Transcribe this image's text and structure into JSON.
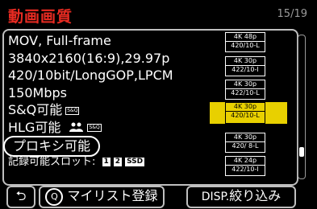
{
  "header": {
    "title": "動画画質",
    "page": "15/19"
  },
  "info": {
    "line1": "MOV, Full-frame",
    "line2": "3840x2160(16:9),29.97p",
    "line3": "420/10bit/LongGOP,LPCM",
    "line4": "150Mbps",
    "line5": "S&Q可能",
    "line5_badge": "S&Q",
    "line6": "HLG可能",
    "line6_badge": "S&Q",
    "line7": "プロキシ可能",
    "line8": "記録可能スロット:",
    "slot1": "1",
    "slot2": "2",
    "slot3": "SSD"
  },
  "modes": [
    {
      "top": "4K 48p",
      "bottom": "420/10-L"
    },
    {
      "top": "4K 30p",
      "bottom": "422/10-I"
    },
    {
      "top": "4K 30p",
      "bottom": "422/10-L"
    },
    {
      "top": "4K 30p",
      "bottom": "420/10-L",
      "selected": true
    },
    {
      "top": "4K 30p",
      "bottom": "420/ 8-L"
    },
    {
      "top": "4K 24p",
      "bottom": "422/10-I"
    }
  ],
  "scroll": {
    "position": 0.84
  },
  "buttons": {
    "back_glyph": "⮌",
    "q_glyph": "Q",
    "q_label": "マイリスト登録",
    "disp_label": "DISP.",
    "disp_action": "絞り込み"
  }
}
